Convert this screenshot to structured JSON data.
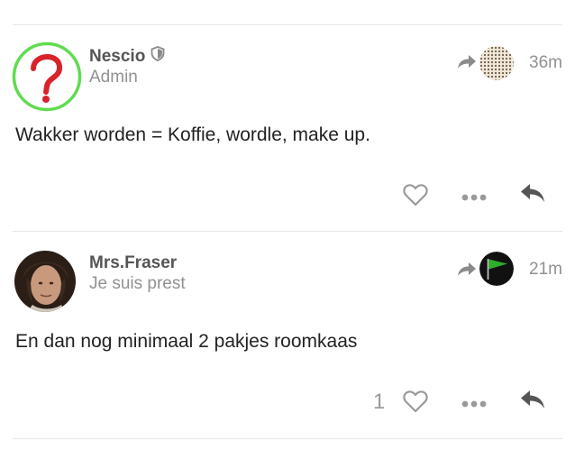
{
  "posts": [
    {
      "username": "Nescio",
      "user_title": "Admin",
      "badge_icon": "shield-icon",
      "time": "36m",
      "content": "Wakker worden = Koffie, wordle, make up.",
      "like_count": ""
    },
    {
      "username": "Mrs.Fraser",
      "user_title": "Je suis prest",
      "time": "21m",
      "content": "En dan nog minimaal 2 pakjes roomkaas",
      "like_count": "1"
    }
  ],
  "colors": {
    "admin_ring": "#5fdc4f",
    "question_mark": "#d8232a",
    "flag": "#2fae2a",
    "icon_gray": "#9a9a9a",
    "text_muted": "#919191"
  }
}
